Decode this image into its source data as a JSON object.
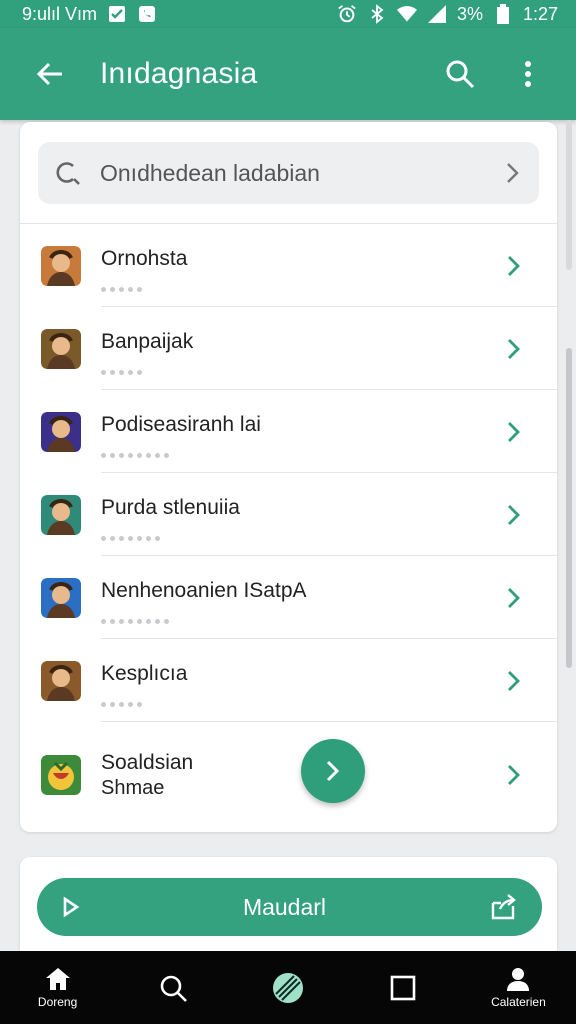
{
  "status_bar": {
    "carrier": "9:ulıl Vım",
    "battery_percent": "3%",
    "time": "1:27"
  },
  "app_bar": {
    "title": "Inıdagnasia"
  },
  "search": {
    "placeholder": "Onıdhedean ladabian"
  },
  "list": {
    "items": [
      {
        "label": "Ornohsta",
        "dots": 5,
        "icon": "warrior-avatar-icon",
        "color": "#c87a3a"
      },
      {
        "label": "Banpaijak",
        "dots": 5,
        "icon": "viking-avatar-icon",
        "color": "#7b5a2a"
      },
      {
        "label": "Podiseasiranh lai",
        "dots": 8,
        "icon": "orb-avatar-icon",
        "color": "#3b2f8a"
      },
      {
        "label": "Purda stlenuiia",
        "dots": 7,
        "icon": "hunter-avatar-icon",
        "color": "#2f8a7a"
      },
      {
        "label": "Nenhenoanien ISatpA",
        "dots": 8,
        "icon": "rocket-avatar-icon",
        "color": "#2a6fc4"
      },
      {
        "label": "Kesplıcıa",
        "dots": 5,
        "icon": "knight-avatar-icon",
        "color": "#8a5a2a"
      }
    ],
    "last_item": {
      "label": "Soaldsian",
      "sublabel": "Shmae",
      "icon": "fruit-avatar-icon",
      "color": "#e4b32a"
    }
  },
  "primary_action": {
    "label": "Maudarl"
  },
  "bottom_nav": {
    "items": [
      {
        "label": "Doreng",
        "icon": "home-icon"
      },
      {
        "label": "",
        "icon": "search-icon"
      },
      {
        "label": "",
        "icon": "compass-icon"
      },
      {
        "label": "",
        "icon": "square-icon"
      },
      {
        "label": "Calaterien",
        "icon": "person-icon"
      }
    ]
  },
  "colors": {
    "accent": "#34a27f",
    "nav_bg": "#060606"
  }
}
